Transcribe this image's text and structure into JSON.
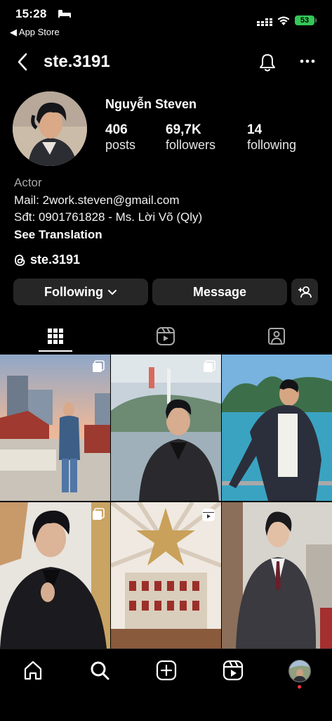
{
  "status": {
    "time": "15:28",
    "back_app": "◀ App Store",
    "battery": "53"
  },
  "header": {
    "username": "ste.3191"
  },
  "profile": {
    "name": "Nguyễn Steven",
    "stats": [
      {
        "value": "406",
        "label": "posts"
      },
      {
        "value": "69,7K",
        "label": "followers"
      },
      {
        "value": "14",
        "label": "following"
      }
    ],
    "category": "Actor",
    "bio_lines": [
      "Mail: 2work.steven@gmail.com",
      "Sđt: 0901761828 - Ms. Lời Võ (Qly)"
    ],
    "see_translation": "See Translation",
    "threads_handle": "ste.3191"
  },
  "actions": {
    "following": "Following",
    "message": "Message"
  },
  "tabs": [
    "grid-icon",
    "reels-icon",
    "tagged-icon"
  ],
  "grid": [
    {
      "badge": "carousel-icon"
    },
    {
      "badge": "carousel-icon"
    },
    {
      "badge": ""
    },
    {
      "badge": "carousel-icon"
    },
    {
      "badge": "reel-icon"
    },
    {
      "badge": ""
    }
  ],
  "nav": [
    "home-icon",
    "search-icon",
    "create-icon",
    "reels-icon",
    "profile-avatar"
  ]
}
